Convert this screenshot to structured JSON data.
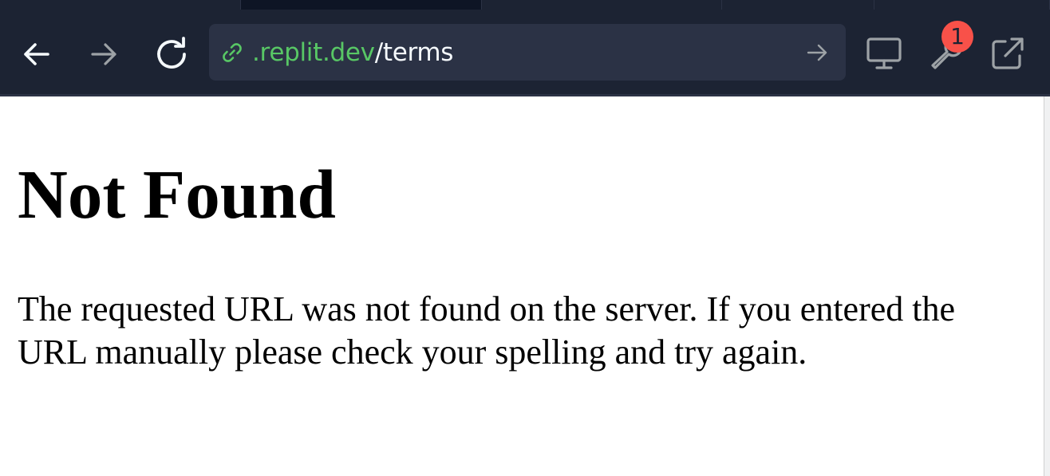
{
  "toolbar": {
    "back_icon": "arrow-left-icon",
    "forward_icon": "arrow-right-icon",
    "reload_icon": "refresh-icon",
    "url": {
      "link_icon": "link-icon",
      "host": ".replit.dev",
      "path": "/terms",
      "go_icon": "arrow-right-icon"
    },
    "devices_icon": "monitor-icon",
    "devtools_icon": "wrench-icon",
    "devtools_badge": "1",
    "open_new_tab_icon": "external-link-icon"
  },
  "page": {
    "title": "Not Found",
    "message": "The requested URL was not found on the server. If you entered the URL manually please check your spelling and try again."
  },
  "colors": {
    "toolbar_bg": "#1c2333",
    "urlbar_bg": "#2b3245",
    "host_color": "#58c765",
    "badge_color": "#f85149"
  }
}
